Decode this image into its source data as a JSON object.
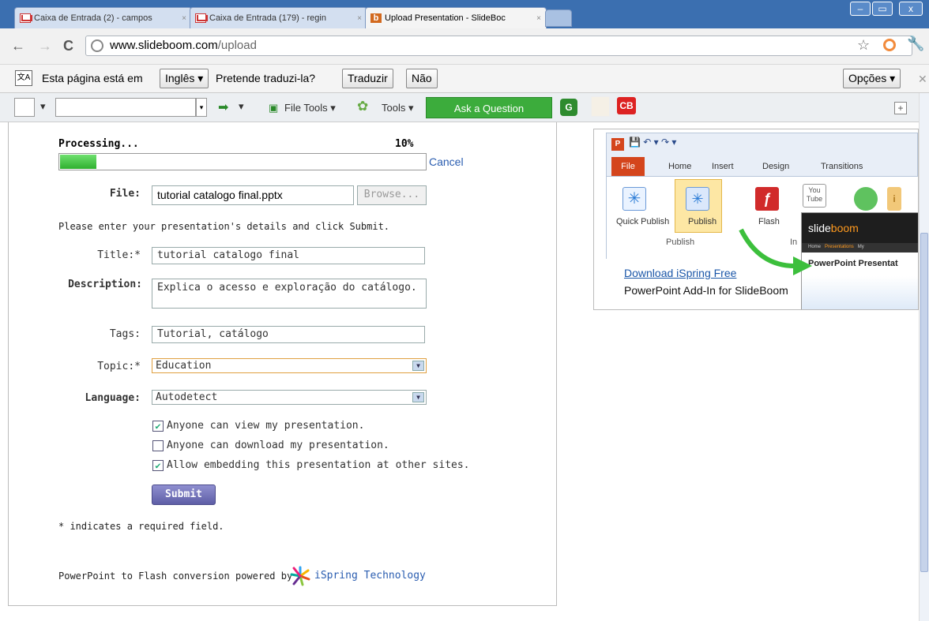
{
  "browser": {
    "tabs": [
      {
        "label": "Caixa de Entrada (2) - campos",
        "icon": "gmail-icon"
      },
      {
        "label": "Caixa de Entrada (179) - regin",
        "icon": "gmail-icon"
      },
      {
        "label": "Upload Presentation - SlideBoc",
        "icon": "slideboom-icon"
      }
    ],
    "close_glyph": "×",
    "url_host": "www.slideboom.com",
    "url_path": "/upload",
    "window_buttons": {
      "minimize": "–",
      "maximize": "▭",
      "close": "x"
    }
  },
  "translate_bar": {
    "message": "Esta página está em",
    "language": "Inglês",
    "question": "Pretende traduzi-la?",
    "translate_button": "Traduzir",
    "no_button": "Não",
    "options_button": "Opções",
    "icon_text": "文A"
  },
  "addon_toolbar": {
    "file_tools": "File Tools",
    "tools": "Tools",
    "ask_question": "Ask a Question",
    "g_label": "G",
    "cb_label": "CB"
  },
  "upload": {
    "processing_label": "Processing...",
    "progress_percent": "10%",
    "progress_fraction": 0.1,
    "cancel_label": "Cancel",
    "file_label": "File:",
    "file_value": "tutorial catalogo final.pptx",
    "browse_label": "Browse...",
    "instructions": "Please enter your presentation's details and click Submit.",
    "title_label": "Title:*",
    "title_value": "tutorial catalogo final",
    "description_label": "Description:",
    "description_value": "Explica o acesso e exploração do catálogo.",
    "tags_label": "Tags:",
    "tags_value": "Tutorial, catálogo",
    "topic_label": "Topic:*",
    "topic_value": "Education",
    "language_label": "Language:",
    "language_value": "Autodetect",
    "options": [
      {
        "label": "Anyone can view my presentation.",
        "checked": true
      },
      {
        "label": "Anyone can download my presentation.",
        "checked": false
      },
      {
        "label": "Allow embedding this presentation at other sites.",
        "checked": true
      }
    ],
    "submit_label": "Submit",
    "required_note": "* indicates a required field.",
    "powered_by": "PowerPoint to Flash conversion powered by",
    "powered_brand": "iSpring Technology"
  },
  "ad": {
    "ribbon_tabs": [
      "File",
      "Home",
      "Insert",
      "Design",
      "Transitions"
    ],
    "buttons": [
      "Quick Publish",
      "Publish",
      "Flash"
    ],
    "group_label": "Publish",
    "group_label_2": "In",
    "youtube_label": "You\nTube",
    "slideboom_logo_a": "slide",
    "slideboom_logo_b": "boom",
    "sb_nav": [
      "Home",
      "Presentations",
      "My"
    ],
    "sb_title": "PowerPoint Presentat",
    "link": "Download iSpring Free",
    "subtitle": "PowerPoint Add-In for SlideBoom"
  },
  "colors": {
    "accent_green": "#3cac3c",
    "link_blue": "#1a56a8",
    "submit_purple": "#6a6ab0"
  }
}
